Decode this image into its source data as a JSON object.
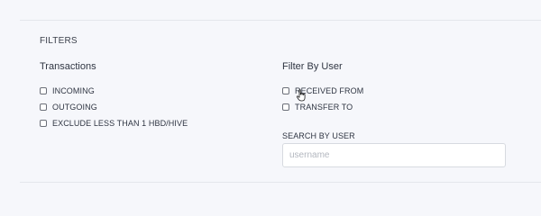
{
  "filters": {
    "title": "FILTERS",
    "transactions": {
      "title": "Transactions",
      "options": [
        {
          "label": "INCOMING",
          "checked": false
        },
        {
          "label": "OUTGOING",
          "checked": false
        },
        {
          "label": "EXCLUDE LESS THAN 1 HBD/HIVE",
          "checked": false
        }
      ]
    },
    "by_user": {
      "title": "Filter By User",
      "options": [
        {
          "label": "RECEIVED FROM",
          "checked": false
        },
        {
          "label": "TRANSFER TO",
          "checked": false
        }
      ],
      "search_label": "SEARCH BY USER",
      "search_placeholder": "username",
      "search_value": ""
    }
  },
  "cursor": {
    "icon": "hand-pointer-icon"
  }
}
